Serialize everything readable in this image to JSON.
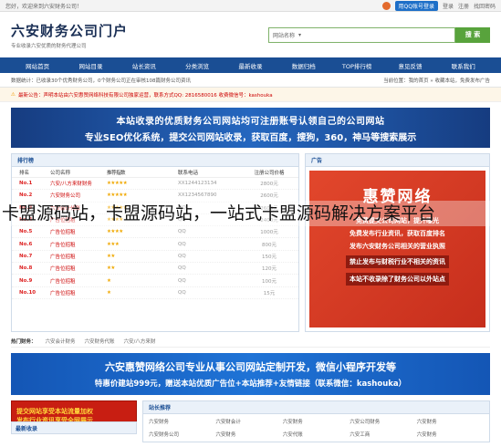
{
  "topbar": {
    "welcome": "您好，欢迎来到六安财务公司！",
    "qq_login": "用QQ账号登录",
    "login": "登录",
    "register": "注册",
    "help": "找回密码"
  },
  "header": {
    "title": "六安财务公司门户",
    "subtitle": "专业收录六安优质的财务代理公司",
    "search_select": "网站名称",
    "search_button": "搜 索"
  },
  "nav": [
    "网站首页",
    "网站目录",
    "站长资讯",
    "分类浏览",
    "最新收录",
    "数据归档",
    "TOP排行榜",
    "意见反馈",
    "联系我们"
  ],
  "stats": {
    "left": "数据统计：已收录30个优秀财务公司，0个财务公司正在审核108篇财务公司资讯",
    "right": "当前位置：我的首页 » 收藏本站，免费发布广告"
  },
  "notice": "最新公告：声明本站由六安惠赞网络科技有限公司独家运营，联系方式QQ: 2816580016 收费微信号：kashouka",
  "banner_top": {
    "line1": "本站收录的优质财务公司网站均可注册账号认领自己的公司网站",
    "line2": "专业SEO优化系统，提交公司网站收录，获取百度，搜狗，360，神马等搜索展示"
  },
  "rank": {
    "title": "排行榜",
    "headers": [
      "排名",
      "公司名称",
      "推荐指数",
      "联系电话",
      "注册公司价格"
    ],
    "rows": [
      {
        "no": "No.1",
        "name": "六安/八方来财财务",
        "stars": "★★★★★",
        "phone": "XX1244123134",
        "price": "2800元"
      },
      {
        "no": "No.2",
        "name": "六安财务公司",
        "stars": "★★★★★",
        "phone": "XX1234567890",
        "price": "2600元"
      },
      {
        "no": "No.3",
        "name": "六安会计代账",
        "stars": "★★★★★",
        "phone": "QQ",
        "price": "2600元"
      },
      {
        "no": "No.4",
        "name": "广告位招租",
        "stars": "★★★★",
        "phone": "QQ",
        "price": "2400元"
      },
      {
        "no": "No.5",
        "name": "广告位招租",
        "stars": "★★★★",
        "phone": "QQ",
        "price": "1000元"
      },
      {
        "no": "No.6",
        "name": "广告位招租",
        "stars": "★★★",
        "phone": "QQ",
        "price": "800元"
      },
      {
        "no": "No.7",
        "name": "广告位招租",
        "stars": "★★",
        "phone": "QQ",
        "price": "150元"
      },
      {
        "no": "No.8",
        "name": "广告位招租",
        "stars": "★★",
        "phone": "QQ",
        "price": "120元"
      },
      {
        "no": "No.9",
        "name": "广告位招租",
        "stars": "★",
        "phone": "QQ",
        "price": "100元"
      },
      {
        "no": "No.10",
        "name": "广告位招租",
        "stars": "★",
        "phone": "QQ",
        "price": "15元"
      }
    ]
  },
  "ad": {
    "title": "广告",
    "brand": "惠赞网络",
    "l1": "免费提交公司网站，提升曝光",
    "l2": "免费发布行业资讯，获取百度排名",
    "l3": "发布六安财务公司相关的营业执照",
    "l4": "禁止发布与财税行业不相关的资讯",
    "l5": "本站不收录除了财务公司以外站点"
  },
  "hot": {
    "label": "热门财务：",
    "items": [
      "六安会计财务",
      "六安财务代账",
      "六安/八方来财"
    ]
  },
  "banner_bottom": {
    "line1": "六安惠赞网络公司专业从事公司网站定制开发，微信小程序开发等",
    "line2": "特惠价建站999元，赠送本站优质广告位+本站推荐+友情链接（联系微信：kashouka）"
  },
  "promo": {
    "l1": "提交网站享受本站流量加权",
    "l2": "发布行业资讯享受全网展示"
  },
  "rec": {
    "title": "站长推荐",
    "items": [
      "六安财务",
      "六安财会计",
      "六安财务",
      "六安公司财务",
      "六安财务",
      "六安财务公司",
      "六安财务",
      "六安代账",
      "六安工商",
      "六安财务"
    ]
  },
  "newest": "最新收录",
  "caption": "卡盟源码站，卡盟源码站，一站式卡盟源码解决方案平台"
}
